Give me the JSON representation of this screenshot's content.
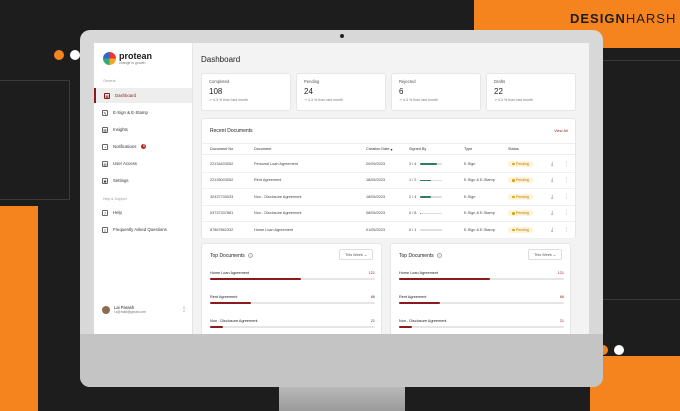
{
  "brand": {
    "part1": "DESIGN",
    "part2": "HARSH"
  },
  "app": {
    "name": "protean",
    "tagline": "change is growth"
  },
  "sidebar": {
    "general_label": "General",
    "support_label": "Help & Support",
    "items": [
      {
        "label": "Dashboard",
        "icon": "grid-icon"
      },
      {
        "label": "E-Sign & E-Stamp",
        "icon": "pen-icon"
      },
      {
        "label": "Insights",
        "icon": "chart-icon"
      },
      {
        "label": "Notifications",
        "icon": "bell-icon",
        "badge": "8"
      },
      {
        "label": "User Access",
        "icon": "user-icon"
      },
      {
        "label": "Settings",
        "icon": "gear-icon"
      }
    ],
    "support_items": [
      {
        "label": "Help",
        "icon": "help-icon"
      },
      {
        "label": "Frequently Asked Questions",
        "icon": "faq-icon"
      }
    ],
    "user": {
      "name": "Lai Parash",
      "email": "l.s@mail@gmail.com"
    }
  },
  "page_title": "Dashboard",
  "stats": [
    {
      "label": "Completed",
      "value": "108",
      "delta": "4.3 % from last month"
    },
    {
      "label": "Pending",
      "value": "24",
      "delta": "4.3 % from last month"
    },
    {
      "label": "Rejected",
      "value": "6",
      "delta": "4.3 % from last month"
    },
    {
      "label": "Drafts",
      "value": "22",
      "delta": "4.3 % from last month"
    }
  ],
  "recent": {
    "title": "Recent Documents",
    "view_all": "View All",
    "columns": [
      "Document No",
      "Document",
      "Creation Date",
      "Signed By",
      "Type",
      "Status"
    ],
    "rows": [
      {
        "no": "22134403052",
        "doc": "Personal Loan Agreement",
        "date": "20/05/2023",
        "signed": "3 / 4",
        "progress": 0.75,
        "type": "E-Sign",
        "status": "Pending"
      },
      {
        "no": "22135003052",
        "doc": "Rent Agreement",
        "date": "18/05/2023",
        "signed": "1 / 2",
        "progress": 0.5,
        "type": "E-Sign & E-Stamp",
        "status": "Pending"
      },
      {
        "no": "32437703033",
        "doc": "Non - Disclosure Agreement",
        "date": "18/05/2023",
        "signed": "2 / 4",
        "progress": 0.5,
        "type": "E-Sign",
        "status": "Pending"
      },
      {
        "no": "53737337881",
        "doc": "Non - Disclosure Agreement",
        "date": "08/05/2023",
        "signed": "0 / 8",
        "progress": 0.05,
        "type": "E-Sign & E-Stamp",
        "status": "Pending"
      },
      {
        "no": "87867862332",
        "doc": "Home Loan Agreement",
        "date": "01/05/2023",
        "signed": "0 / 1",
        "progress": 0.0,
        "type": "E-Sign & E-Stamp",
        "status": "Pending"
      }
    ]
  },
  "top_docs": [
    {
      "title": "Top Documents",
      "filter": "This Week",
      "items": [
        {
          "label": "Home Loan Agreement",
          "value": "121",
          "fraction": 0.55
        },
        {
          "label": "Rent Agreement",
          "value": "86",
          "fraction": 0.25
        },
        {
          "label": "Non - Disclosure Agreement",
          "value": "21",
          "fraction": 0.08
        }
      ]
    },
    {
      "title": "Top Documents",
      "filter": "This Week",
      "items": [
        {
          "label": "Home Loan Agreement",
          "value": "121",
          "fraction": 0.55
        },
        {
          "label": "Rent Agreement",
          "value": "86",
          "fraction": 0.25
        },
        {
          "label": "Non - Disclosure Agreement",
          "value": "21",
          "fraction": 0.08
        }
      ]
    }
  ]
}
